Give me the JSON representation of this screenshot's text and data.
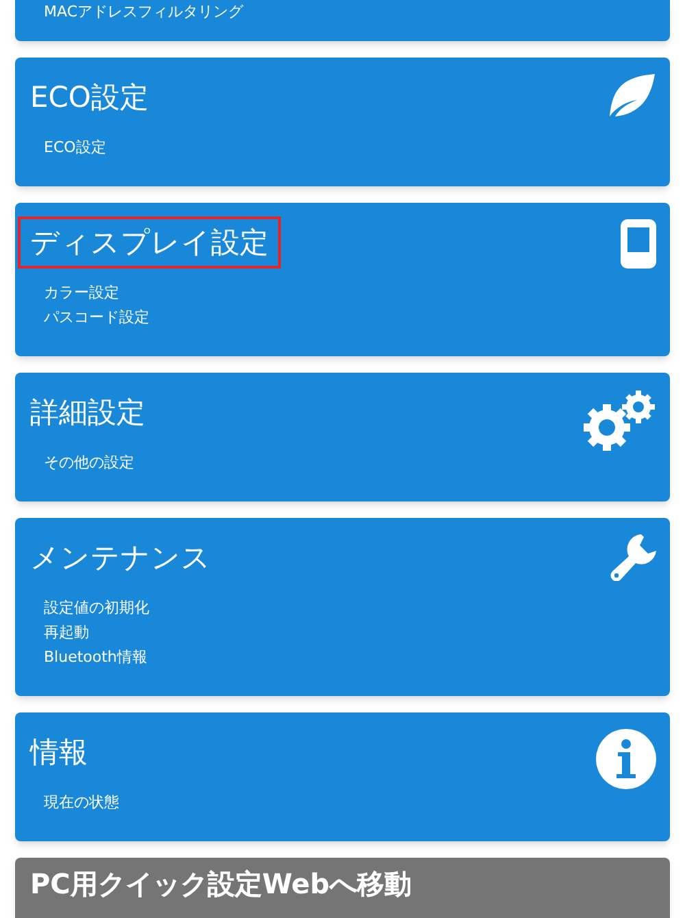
{
  "cards": [
    {
      "kind": "partial",
      "items": [
        "MACアドレスフィルタリング"
      ]
    },
    {
      "kind": "menu",
      "title": "ECO設定",
      "highlighted": false,
      "items": [
        "ECO設定"
      ]
    },
    {
      "kind": "menu",
      "title": "ディスプレイ設定",
      "highlighted": true,
      "items": [
        "カラー設定",
        "パスコード設定"
      ]
    },
    {
      "kind": "menu",
      "title": "詳細設定",
      "highlighted": false,
      "items": [
        "その他の設定"
      ]
    },
    {
      "kind": "menu",
      "title": "メンテナンス",
      "highlighted": false,
      "items": [
        "設定値の初期化",
        "再起動",
        "Bluetooth情報"
      ]
    },
    {
      "kind": "menu",
      "title": "情報",
      "highlighted": false,
      "items": [
        "現在の状態"
      ]
    },
    {
      "kind": "link",
      "title": "PC用クイック設定Webへ移動"
    }
  ]
}
